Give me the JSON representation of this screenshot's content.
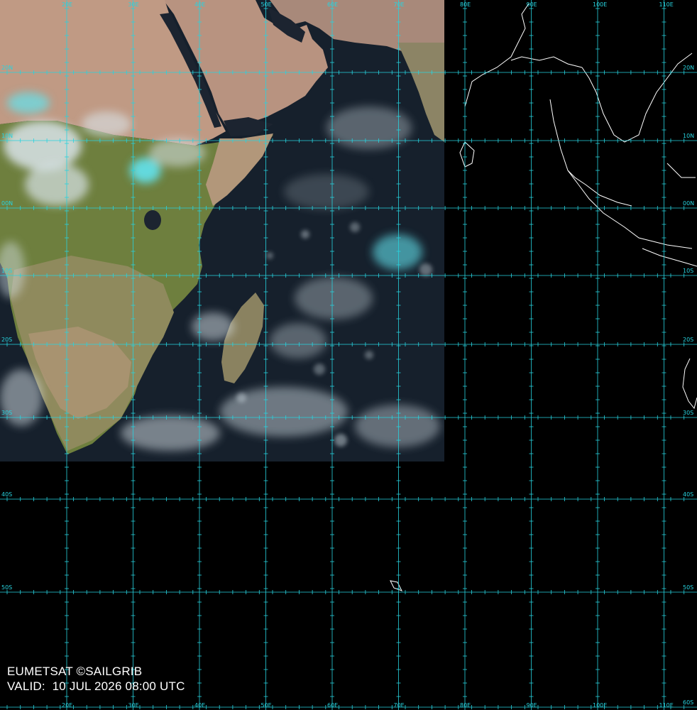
{
  "caption": {
    "source": "EUMETSAT ©SAILGRIB",
    "valid": "VALID:  10 JUL 2026 08:00 UTC"
  },
  "colors": {
    "grid": "#27d3df",
    "background": "#000000",
    "ocean": "#16202c",
    "desert": "#b89380",
    "vegetation": "#6e7f3e",
    "savanna": "#8f8a5d",
    "cloud": "#d9e4ea",
    "cloud_cyan": "#63e3ee",
    "coastline": "#ffffff"
  },
  "grid": {
    "longitudes": [
      "20E",
      "30E",
      "40E",
      "50E",
      "60E",
      "70E",
      "80E",
      "90E",
      "100E",
      "110E"
    ],
    "top_longitudes": [
      "20E",
      "30E",
      "40E",
      "50E",
      "60E",
      "70E",
      "80E",
      "90E",
      "100E",
      "110E"
    ],
    "latitudes": [
      "20N",
      "10N",
      "00N",
      "10S",
      "20S",
      "30S",
      "40S",
      "50S",
      "60S"
    ],
    "left_latitudes": [
      "20N",
      "10N",
      "00N",
      "10S",
      "20S",
      "30S",
      "40S",
      "50S"
    ]
  }
}
